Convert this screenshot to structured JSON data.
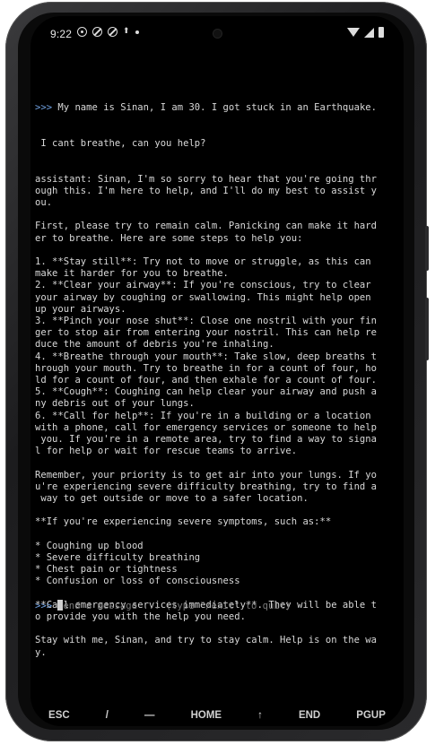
{
  "status": {
    "time": "9:22"
  },
  "terminal": {
    "prompt": ">>> ",
    "user_line_1": "My name is Sinan, I am 30. I got stuck in an Earthquake.",
    "user_line_2": " I cant breathe, can you help?",
    "lines": [
      "assistant: Sinan, I'm so sorry to hear that you're going thr",
      "ough this. I'm here to help, and I'll do my best to assist y",
      "ou.",
      "",
      "First, please try to remain calm. Panicking can make it hard",
      "er to breathe. Here are some steps to help you:",
      "",
      "1. **Stay still**: Try not to move or struggle, as this can",
      "make it harder for you to breathe.",
      "2. **Clear your airway**: If you're conscious, try to clear",
      "your airway by coughing or swallowing. This might help open",
      "up your airways.",
      "3. **Pinch your nose shut**: Close one nostril with your fin",
      "ger to stop air from entering your nostril. This can help re",
      "duce the amount of debris you're inhaling.",
      "4. **Breathe through your mouth**: Take slow, deep breaths t",
      "hrough your mouth. Try to breathe in for a count of four, ho",
      "ld for a count of four, and then exhale for a count of four.",
      "5. **Cough**: Coughing can help clear your airway and push a",
      "ny debris out of your lungs.",
      "6. **Call for help**: If you're in a building or a location",
      "with a phone, call for emergency services or someone to help",
      " you. If you're in a remote area, try to find a way to signa",
      "l for help or wait for rescue teams to arrive.",
      "",
      "Remember, your priority is to get air into your lungs. If yo",
      "u're experiencing severe difficulty breathing, try to find a",
      " way to get outside or move to a safer location.",
      "",
      "**If you're experiencing severe symptoms, such as:**",
      "",
      "* Coughing up blood",
      "* Severe difficulty breathing",
      "* Chest pain or tightness",
      "* Confusion or loss of consciousness",
      "",
      "**Call emergency services immediately**. They will be able t",
      "o provide you with the help you need.",
      "",
      "Stay with me, Sinan, and try to stay calm. Help is on the wa",
      "y."
    ],
    "input_placeholder": "end a message ... (type \"/exit\" to quit)"
  },
  "keys": [
    "ESC",
    "/",
    "—",
    "HOME",
    "↑",
    "END",
    "PGUP"
  ]
}
